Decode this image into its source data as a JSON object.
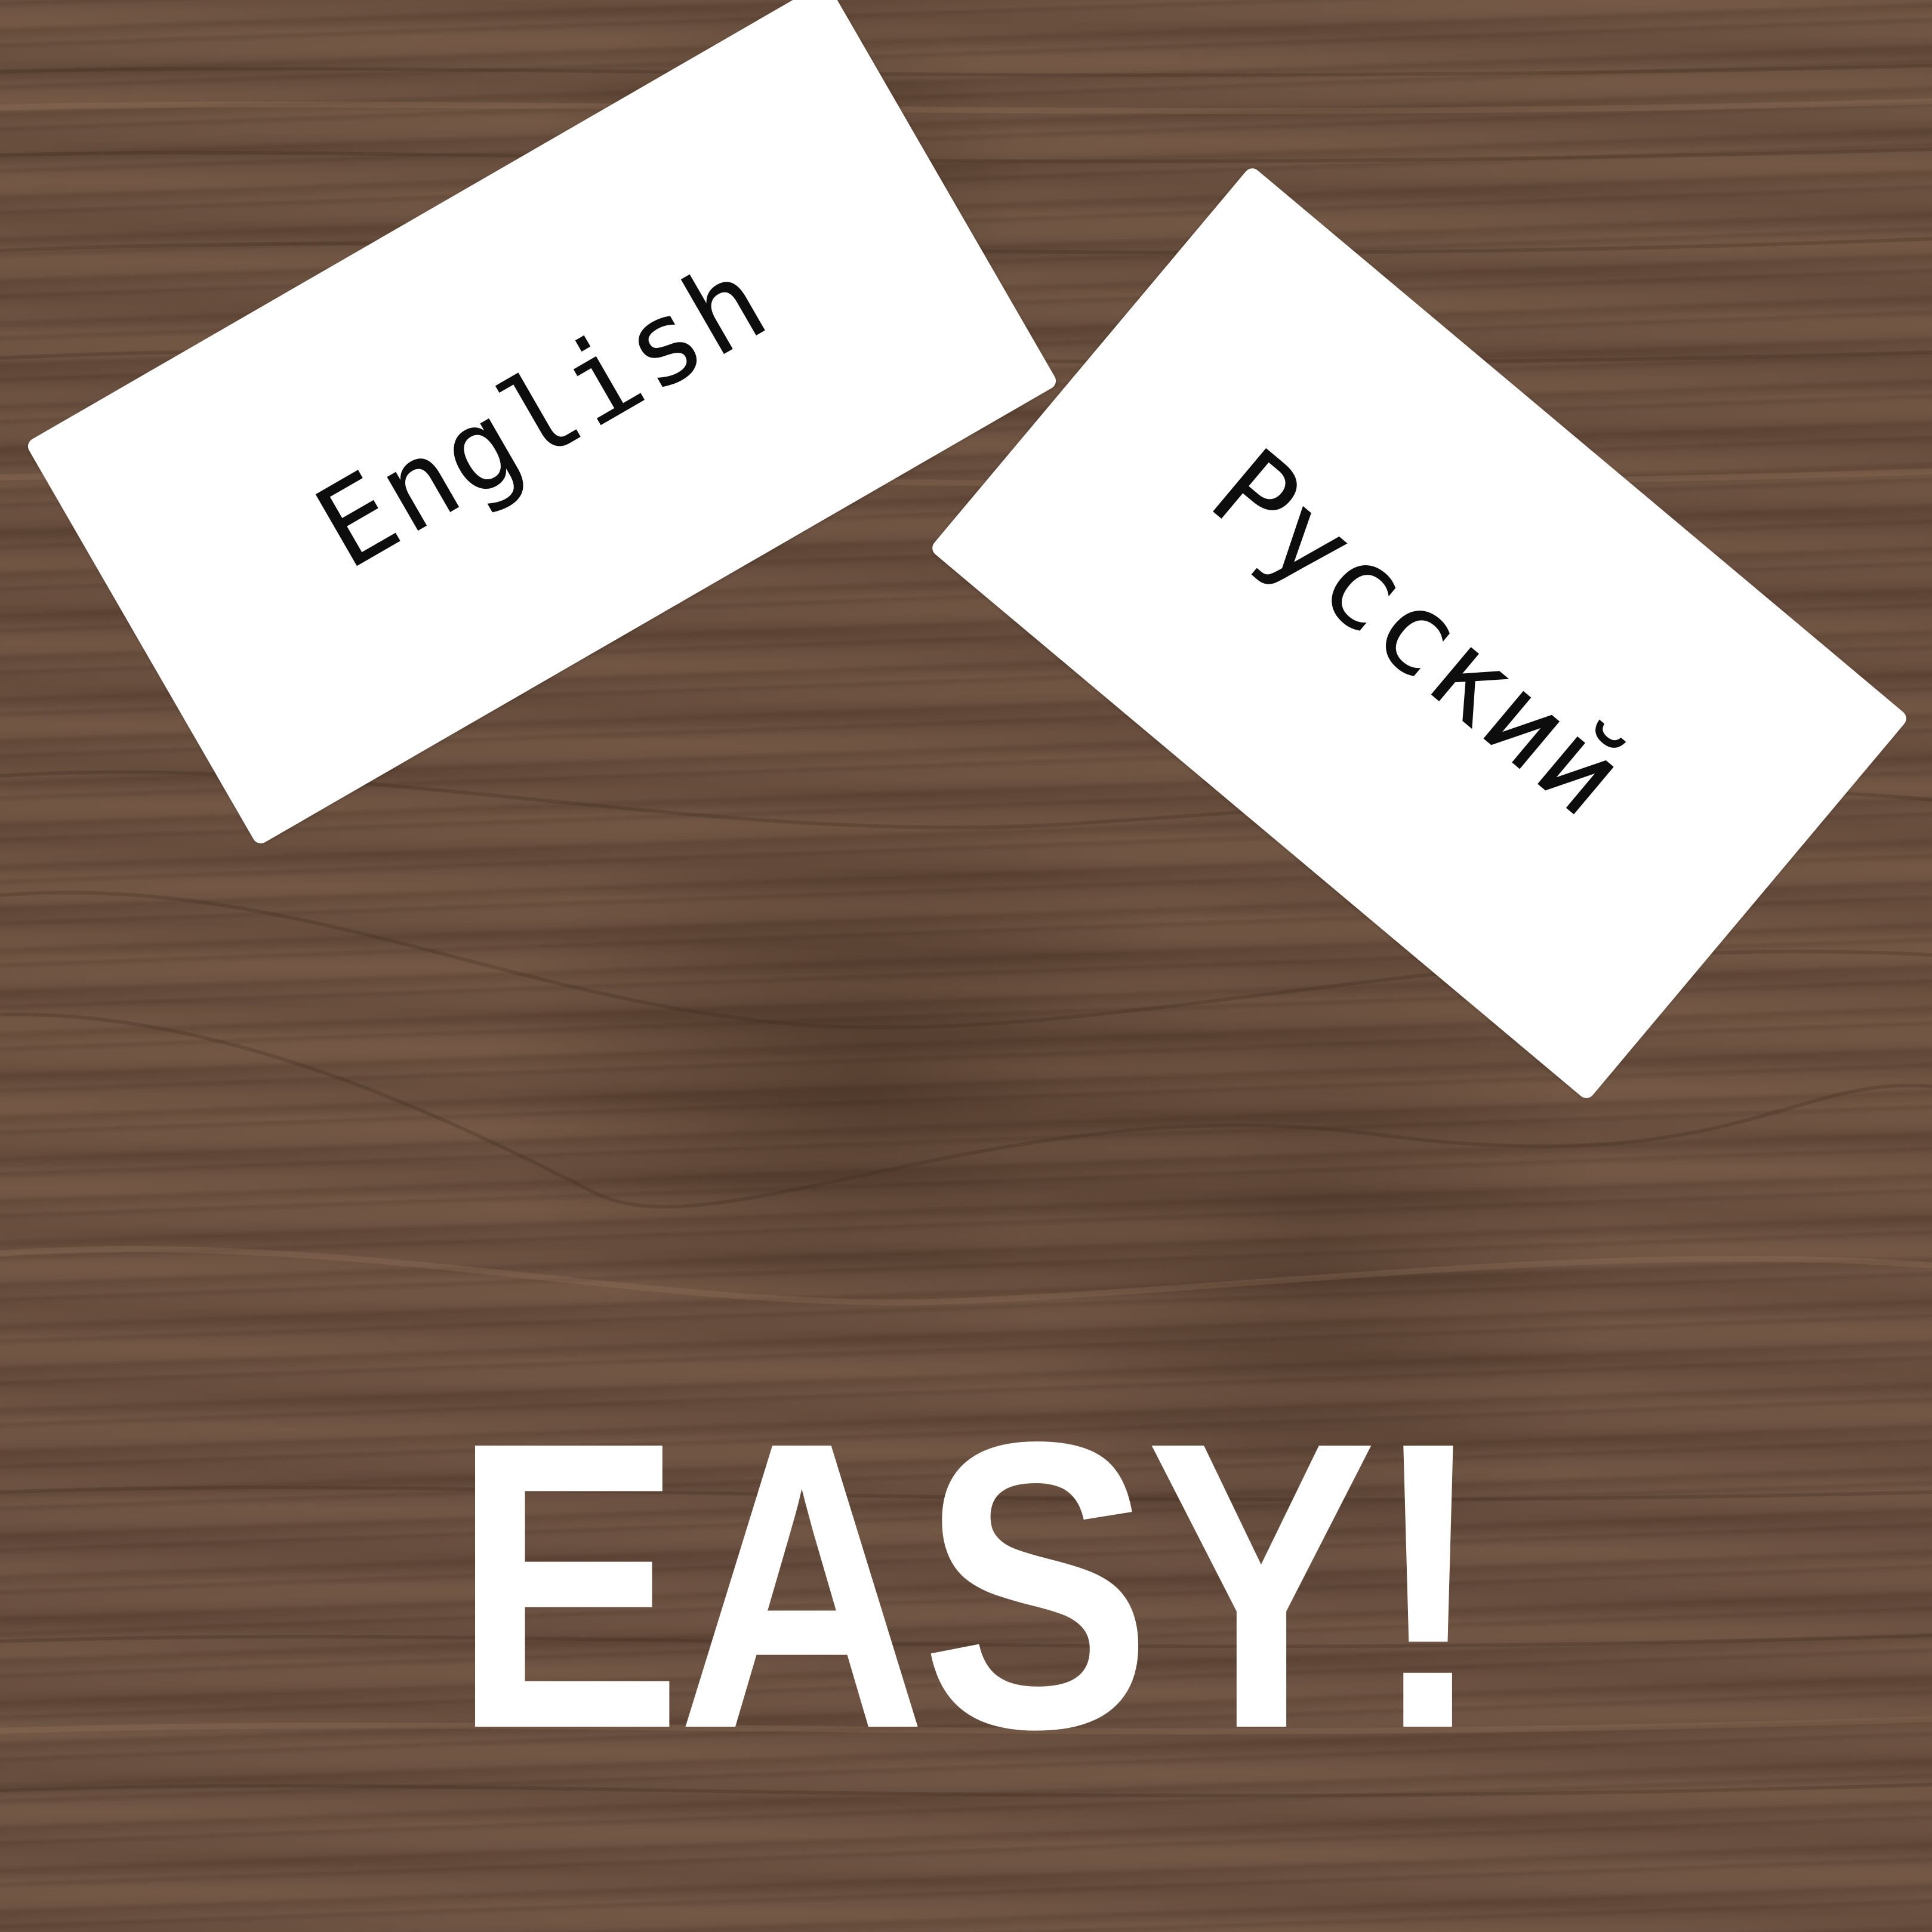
{
  "cards": {
    "english": {
      "label": "English"
    },
    "russian": {
      "label": "Русский"
    }
  },
  "headline": "EASY!",
  "colors": {
    "wood": "#6d5343",
    "card": "#ffffff",
    "card_text": "#0d0d0d",
    "headline": "#ffffff"
  }
}
